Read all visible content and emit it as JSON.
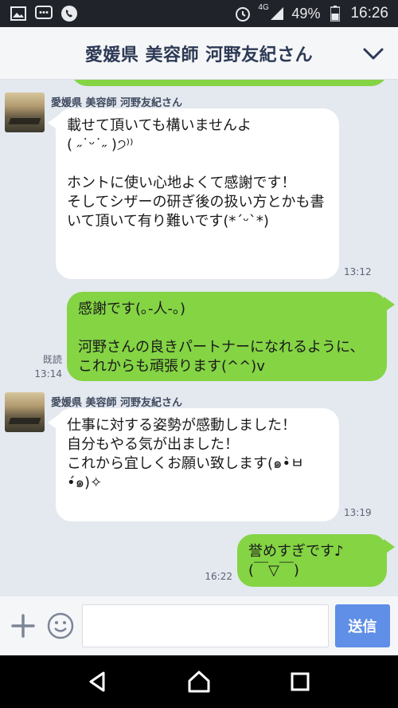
{
  "status_bar": {
    "network": "4G",
    "battery": "49%",
    "time": "16:26"
  },
  "header": {
    "title": "愛媛県 美容師 河野友紀さん"
  },
  "messages": [
    {
      "direction": "in",
      "sender": "愛媛県 美容師 河野友紀さん",
      "text": "載せて頂いても構いませんよ\n( ˶˙ᵕ˙˶ )੭⁾⁾\n\nホントに使い心地よくて感謝です！\nそしてシザーの研ぎ後の扱い方とかも書いて頂いて有り難いです(*ˊᵕˋ*)",
      "time": "13:12"
    },
    {
      "direction": "out",
      "text": "感謝です(｡-人-｡)\n\n河野さんの良きパートナーになれるように、これからも頑張ります(^^)v",
      "read": "既読",
      "time": "13:14"
    },
    {
      "direction": "in",
      "sender": "愛媛県 美容師 河野友紀さん",
      "text": "仕事に対する姿勢が感動しました！\n自分もやる気が出ました！\nこれから宜しくお願い致します(๑•̀ㅂ•́๑)✧",
      "time": "13:19"
    },
    {
      "direction": "out",
      "text": "誉めすぎです♪\n(￣▽￣)",
      "time": "16:22"
    }
  ],
  "composer": {
    "placeholder": "",
    "send_label": "送信"
  },
  "colors": {
    "accent_green": "#84d444",
    "send_blue": "#5f8fe6",
    "header_text": "#2d3a55",
    "chat_bg": "#e4e8ef"
  }
}
